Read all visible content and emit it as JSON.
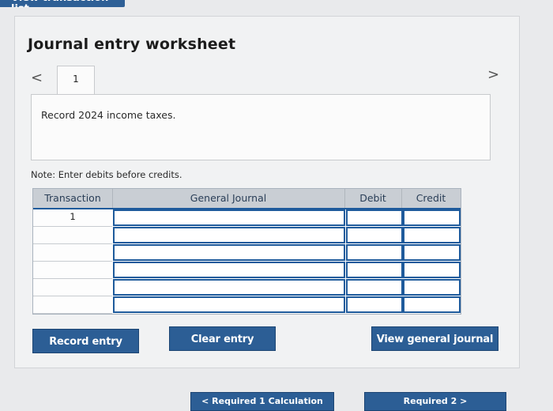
{
  "header": {
    "view_transaction_list": "View transaction list"
  },
  "worksheet": {
    "title": "Journal entry worksheet",
    "prev": "<",
    "next": ">",
    "tabs": [
      {
        "label": "1"
      }
    ],
    "instruction": "Record 2024 income taxes.",
    "note": "Note: Enter debits before credits."
  },
  "journal": {
    "columns": [
      "Transaction",
      "General Journal",
      "Debit",
      "Credit"
    ],
    "rows": [
      {
        "transaction": "1",
        "general_journal": "",
        "debit": "",
        "credit": ""
      },
      {
        "transaction": "",
        "general_journal": "",
        "debit": "",
        "credit": ""
      },
      {
        "transaction": "",
        "general_journal": "",
        "debit": "",
        "credit": ""
      },
      {
        "transaction": "",
        "general_journal": "",
        "debit": "",
        "credit": ""
      },
      {
        "transaction": "",
        "general_journal": "",
        "debit": "",
        "credit": ""
      },
      {
        "transaction": "",
        "general_journal": "",
        "debit": "",
        "credit": ""
      }
    ]
  },
  "actions": {
    "record_entry": "Record entry",
    "clear_entry": "Clear entry",
    "view_general_journal": "View general journal"
  },
  "footer": {
    "left_button": "< Required 1 Calculation",
    "right_button": "Required 2 >"
  }
}
